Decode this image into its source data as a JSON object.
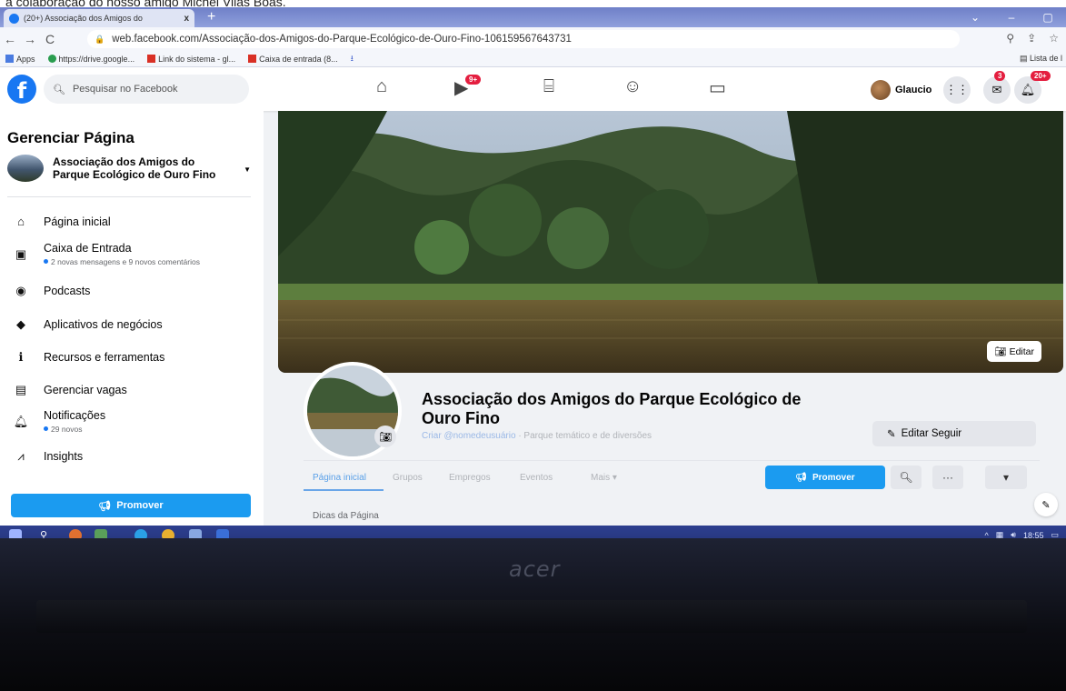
{
  "caption": "a colaboração do nosso amigo Michel Vilas Boas.",
  "browser": {
    "tab_title": "(20+) Associação dos Amigos do",
    "tab_close": "x",
    "new_tab": "+",
    "url": "web.facebook.com/Associação-dos-Amigos-do-Parque-Ecológico-de-Ouro-Fino-106159567643731",
    "bookmarks": [
      "Apps",
      "https://drive.google...",
      "Link do sistema - gl...",
      "Caixa de entrada (8..."
    ],
    "reading_list": "Lista de l"
  },
  "facebook": {
    "search_placeholder": "Pesquisar no Facebook",
    "watch_badge": "9+",
    "user_name": "Glaucio",
    "messenger_badge": "3",
    "notifications_badge": "20+"
  },
  "sidebar": {
    "title": "Gerenciar Página",
    "page_name": "Associação dos Amigos do Parque Ecológico de Ouro Fino",
    "items": [
      {
        "label": "Página inicial",
        "sub": ""
      },
      {
        "label": "Caixa de Entrada",
        "sub": "2 novas mensagens e 9 novos comentários"
      },
      {
        "label": "Podcasts",
        "sub": ""
      },
      {
        "label": "Aplicativos de negócios",
        "sub": ""
      },
      {
        "label": "Recursos e ferramentas",
        "sub": ""
      },
      {
        "label": "Gerenciar vagas",
        "sub": ""
      },
      {
        "label": "Notificações",
        "sub": "29 novos"
      },
      {
        "label": "Insights",
        "sub": ""
      }
    ],
    "promote": "Promover"
  },
  "page": {
    "cover_edit": "Editar",
    "name": "Associação dos Amigos do Parque Ecológico de Ouro Fino",
    "username_link": "Criar @nomedeusuário",
    "category": "· Parque temático e de diversões",
    "edit_follow": "Editar Seguir",
    "tabs": [
      "Página inicial",
      "Grupos",
      "Empregos",
      "Eventos",
      "Mais ▾"
    ],
    "promote": "Promover",
    "below_text": "Dicas da Página"
  },
  "taskbar": {
    "time": "18:55"
  },
  "laptop": {
    "brand": "acer"
  }
}
